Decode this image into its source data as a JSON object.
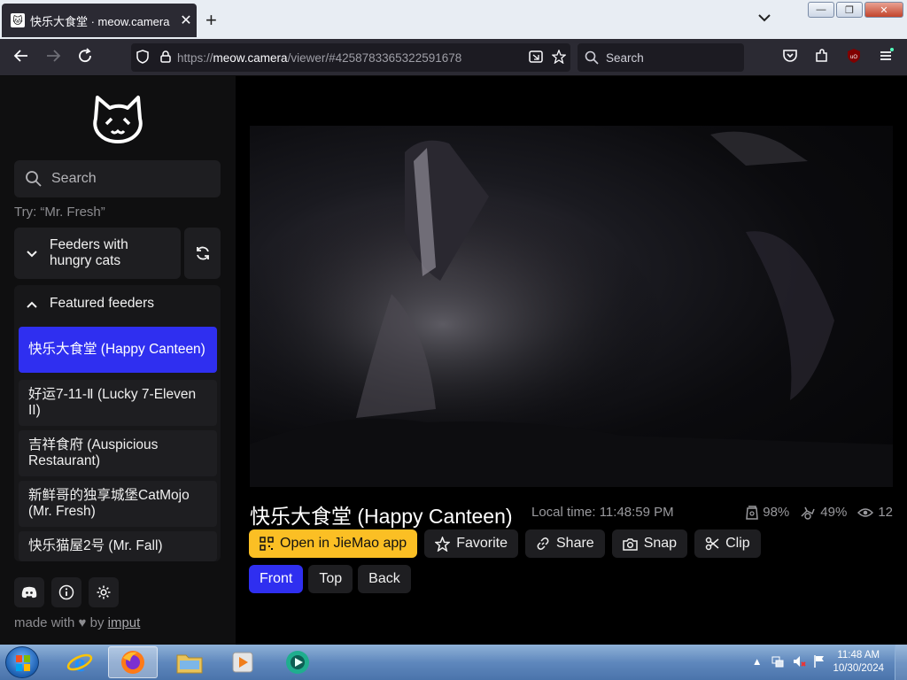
{
  "browser": {
    "tab_title": "快乐大食堂 · meow.camera",
    "tab_favicon": "cat-favicon",
    "url_prefix": "https://",
    "url_host": "meow.camera",
    "url_path": "/viewer/#4258783365322591678",
    "search_placeholder": "Search",
    "window_buttons": {
      "minimize": "—",
      "restore": "❐",
      "close": "✕"
    }
  },
  "sidebar": {
    "search_placeholder": "Search",
    "search_hint": "Try: “Mr. Fresh”",
    "hungry_group_label": "Feeders with hungry cats",
    "featured_group_label": "Featured feeders",
    "feeders": [
      {
        "label": "快乐大食堂 (Happy Canteen)",
        "active": true
      },
      {
        "label": "好运7-11-Ⅱ (Lucky 7-Eleven II)",
        "active": false
      },
      {
        "label": "吉祥食府 (Auspicious Restaurant)",
        "active": false
      },
      {
        "label": "新鲜哥的独享城堡CatMojo (Mr. Fresh)",
        "active": false
      },
      {
        "label": "快乐猫屋2号 (Mr. Fall)",
        "active": false
      }
    ],
    "made_with_prefix": "made with",
    "made_with_by": "by",
    "made_with_author": "imput"
  },
  "camera": {
    "title": "快乐大食堂 (Happy Canteen)",
    "local_time": "Local time: 11:48:59 PM",
    "food_level": "98%",
    "battery_level": "49%",
    "viewers": "12",
    "actions": {
      "open_app": "Open in JieMao app",
      "favorite": "Favorite",
      "share": "Share",
      "snap": "Snap",
      "clip": "Clip"
    },
    "views": [
      "Front",
      "Top",
      "Back"
    ],
    "active_view": "Front"
  },
  "taskbar": {
    "time": "11:48 AM",
    "date": "10/30/2024"
  },
  "colors": {
    "accent": "#2f2ff0",
    "yellow": "#fbbf24",
    "sidebar_bg": "#0f0f10",
    "chrome_bg": "#2b2a33"
  }
}
